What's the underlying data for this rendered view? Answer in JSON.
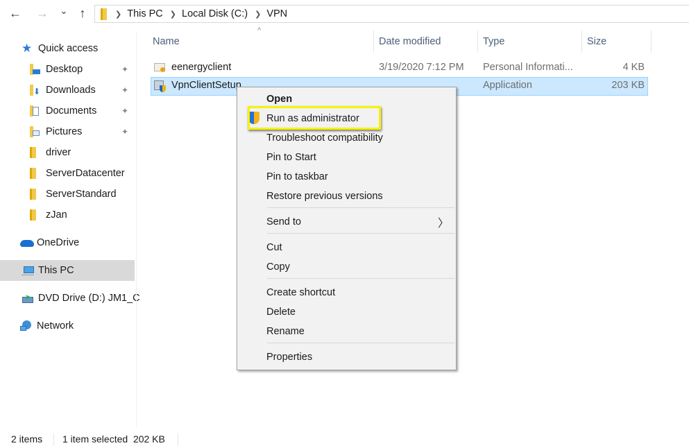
{
  "toolbar": {
    "back_icon": "arrow-left-icon",
    "forward_icon": "arrow-right-icon",
    "recent_icon": "chevron-down-icon",
    "up_icon": "arrow-up-icon",
    "back_glyph": "←",
    "forward_glyph": "→",
    "recent_glyph": "⌄",
    "up_glyph": "↑",
    "breadcrumb": [
      "This PC",
      "Local Disk (C:)",
      "VPN"
    ],
    "separator": "❯"
  },
  "sidebar": {
    "items": [
      {
        "label": "Quick access",
        "icon": "star-icon"
      },
      {
        "label": "Desktop",
        "icon": "desktop-folder-icon",
        "pinned": true
      },
      {
        "label": "Downloads",
        "icon": "downloads-folder-icon",
        "pinned": true
      },
      {
        "label": "Documents",
        "icon": "documents-folder-icon",
        "pinned": true
      },
      {
        "label": "Pictures",
        "icon": "pictures-folder-icon",
        "pinned": true
      },
      {
        "label": "driver",
        "icon": "folder-icon"
      },
      {
        "label": "ServerDatacenter",
        "icon": "folder-icon"
      },
      {
        "label": "ServerStandard",
        "icon": "folder-icon"
      },
      {
        "label": "zJan",
        "icon": "folder-icon"
      },
      {
        "label": "OneDrive",
        "icon": "cloud-icon"
      },
      {
        "label": "This PC",
        "icon": "computer-icon",
        "selected": true
      },
      {
        "label": "DVD Drive (D:) JM1_C",
        "icon": "dvd-drive-icon"
      },
      {
        "label": "Network",
        "icon": "network-icon"
      }
    ],
    "pin_glyph": "📌"
  },
  "columns": {
    "sort_glyph": "^",
    "headers": [
      "Name",
      "Date modified",
      "Type",
      "Size"
    ]
  },
  "files": [
    {
      "name": "eenergyclient",
      "date": "3/19/2020 7:12 PM",
      "type": "Personal Informati...",
      "size": "4 KB",
      "icon": "certificate-file-icon",
      "selected": false
    },
    {
      "name": "VpnClientSetup",
      "date": "",
      "type": "Application",
      "size": "203 KB",
      "icon": "installer-app-icon",
      "selected": true
    }
  ],
  "context_menu": {
    "items": [
      {
        "label": "Open",
        "bold": true
      },
      {
        "label": "Run as administrator",
        "icon": "uac-shield-icon",
        "highlighted": true
      },
      {
        "label": "Troubleshoot compatibility"
      },
      {
        "label": "Pin to Start"
      },
      {
        "label": "Pin to taskbar"
      },
      {
        "label": "Restore previous versions"
      },
      {
        "label": "Send to",
        "submenu": true
      },
      {
        "label": "Cut"
      },
      {
        "label": "Copy"
      },
      {
        "label": "Create shortcut"
      },
      {
        "label": "Delete"
      },
      {
        "label": "Rename"
      },
      {
        "label": "Properties"
      }
    ],
    "submenu_glyph": "〉"
  },
  "status": {
    "item_count": "2 items",
    "selection": "1 item selected  202 KB"
  },
  "colors": {
    "selection_bg": "#cce8ff",
    "selection_border": "#99d1ff",
    "highlight_box": "#f7f200",
    "folder_yellow": "#e8b83a"
  }
}
